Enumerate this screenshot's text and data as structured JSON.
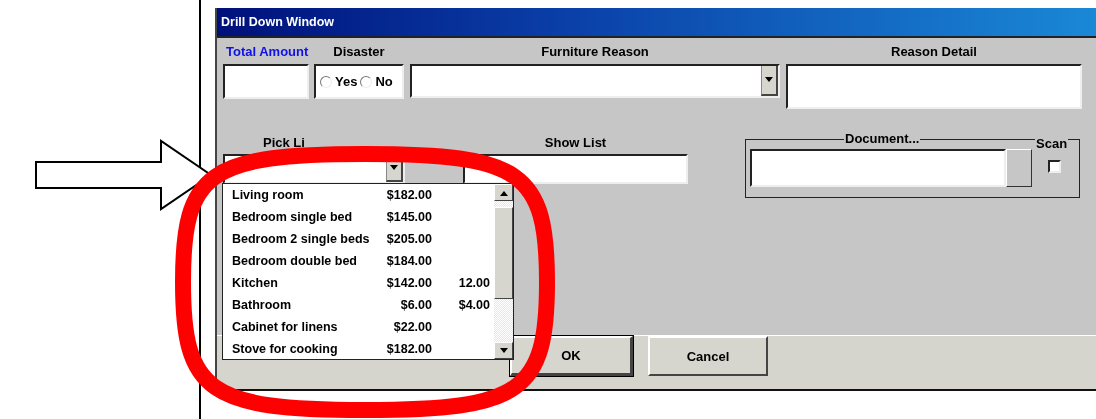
{
  "window": {
    "title": "Drill Down Window"
  },
  "fields": {
    "total_amount": {
      "label": "Total Amount"
    },
    "disaster": {
      "label": "Disaster",
      "options": [
        {
          "label": "Yes",
          "selected": false
        },
        {
          "label": "No",
          "selected": false
        }
      ]
    },
    "furniture_reason": {
      "label": "Furniture Reason"
    },
    "reason_detail": {
      "label": "Reason Detail"
    },
    "pick_list": {
      "label": "Pick Li",
      "expanded": true
    },
    "show_list": {
      "label": "Show List"
    },
    "document": {
      "label": "Document..."
    },
    "scan": {
      "label": "Scan",
      "checked": false
    }
  },
  "pick_list_items": [
    {
      "column_1": "Living room",
      "column_2": "$182.00"
    },
    {
      "column_1": "Bedroom single bed",
      "column_2": "$145.00"
    },
    {
      "column_1": "Bedroom 2 single beds",
      "column_2": "$205.00"
    },
    {
      "column_1": "Bedroom double bed",
      "column_2": "$184.00"
    },
    {
      "column_1": "Kitchen",
      "column_2": "$142.00",
      "column_3": "12.00"
    },
    {
      "column_1": "Bathroom",
      "column_2": "$6.00",
      "column_3": "$4.00"
    },
    {
      "column_1": "Cabinet for linens",
      "column_2": "$22.00"
    },
    {
      "column_1": "Stove for cooking",
      "column_2": "$182.00"
    }
  ],
  "buttons": [
    {
      "label": "OK",
      "default": true
    },
    {
      "label": "Cancel",
      "default": false
    }
  ]
}
